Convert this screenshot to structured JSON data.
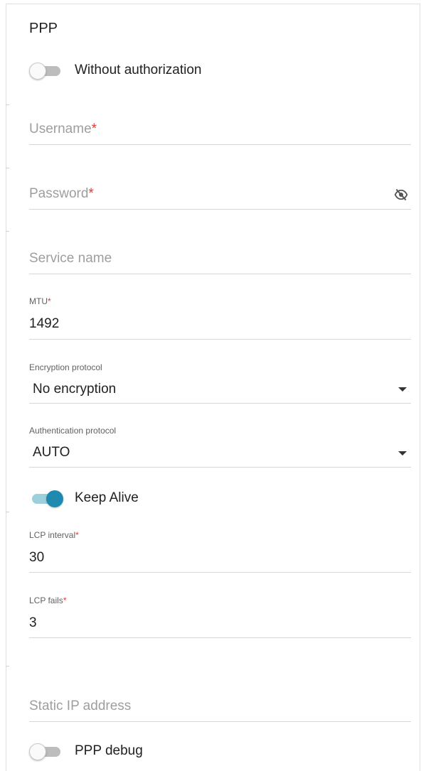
{
  "section": {
    "title": "PPP"
  },
  "toggles": {
    "without_auth": {
      "label": "Without authorization",
      "on": false
    },
    "keep_alive": {
      "label": "Keep Alive",
      "on": true
    },
    "ppp_debug": {
      "label": "PPP debug",
      "on": false
    }
  },
  "fields": {
    "username": {
      "placeholder": "Username",
      "required_mark": "*"
    },
    "password": {
      "placeholder": "Password",
      "required_mark": "*",
      "icon": "eye-slash-icon"
    },
    "service_name": {
      "placeholder": "Service name"
    },
    "mtu": {
      "label": "MTU",
      "required_mark": "*",
      "value": "1492"
    },
    "encryption": {
      "label": "Encryption protocol",
      "value": "No encryption",
      "icon": "caret-down-icon"
    },
    "authentication": {
      "label": "Authentication protocol",
      "value": "AUTO",
      "icon": "caret-down-icon"
    },
    "lcp_interval": {
      "label": "LCP interval",
      "required_mark": "*",
      "value": "30"
    },
    "lcp_fails": {
      "label": "LCP fails",
      "required_mark": "*",
      "value": "3"
    },
    "static_ip": {
      "placeholder": "Static IP address"
    }
  },
  "colors": {
    "accent": "#1e8ab0",
    "accent_track": "#9dd0dc",
    "required": "#e53935"
  }
}
